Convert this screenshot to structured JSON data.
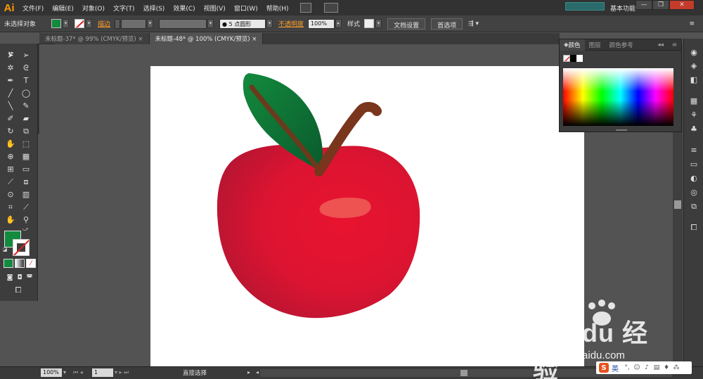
{
  "app": {
    "logo": "Ai"
  },
  "menu": [
    "文件(F)",
    "编辑(E)",
    "对象(O)",
    "文字(T)",
    "选择(S)",
    "效果(C)",
    "视图(V)",
    "窗口(W)",
    "帮助(H)"
  ],
  "workspace": "基本功能",
  "window_controls": {
    "minimize": "—",
    "maximize": "❐",
    "close": "✕"
  },
  "control_bar": {
    "selection_status": "未选择对象",
    "stroke_label": "描边",
    "brush_label": "5 点圆形",
    "opacity_label": "不透明度",
    "opacity_value": "100%",
    "style_label": "样式",
    "doc_setup_button": "文档设置",
    "preferences_button": "首选项"
  },
  "tabs": [
    {
      "label": "未标题-37* @ 99% (CMYK/预览)",
      "close": "×"
    },
    {
      "label": "未标题-48* @ 100% (CMYK/预览)",
      "close": "×"
    }
  ],
  "color_panel": {
    "tabs": [
      "颜色",
      "图层",
      "颜色参考"
    ]
  },
  "status_bar": {
    "zoom": "100%",
    "page": "1",
    "current_tool": "直接选择"
  },
  "watermark": {
    "main": "Bai du 经验",
    "sub": "jingyan.baidu.com"
  },
  "ime": {
    "logo": "S",
    "lang": "英"
  },
  "colors": {
    "fill": "#138a3e",
    "apple": "#dd1430",
    "leaf": "#0e6a35",
    "stem": "#7a351d"
  }
}
